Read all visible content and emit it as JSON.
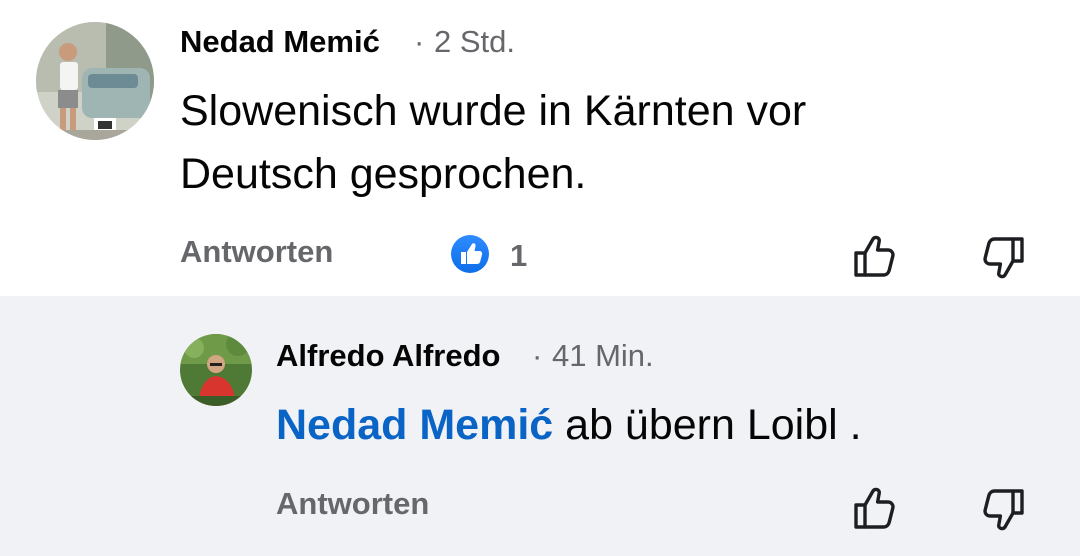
{
  "comments": [
    {
      "author": "Nedad Memić",
      "separator": "·",
      "time": "2 Std.",
      "text_line1": "Slowenisch wurde in Kärnten vor",
      "text_line2": "Deutsch gesprochen.",
      "reply_label": "Antworten",
      "reaction": {
        "icon": "like-icon",
        "count": "1"
      }
    }
  ],
  "replies": [
    {
      "author": "Alfredo Alfredo",
      "separator": "·",
      "time": "41 Min.",
      "mention": "Nedad Memić",
      "text": " ab übern Loibl .",
      "reply_label": "Antworten"
    }
  ],
  "colors": {
    "mention": "#0a64c6",
    "reply_background": "#f0f2f5",
    "meta_text": "#65676b",
    "like_badge": "#1877f2"
  }
}
